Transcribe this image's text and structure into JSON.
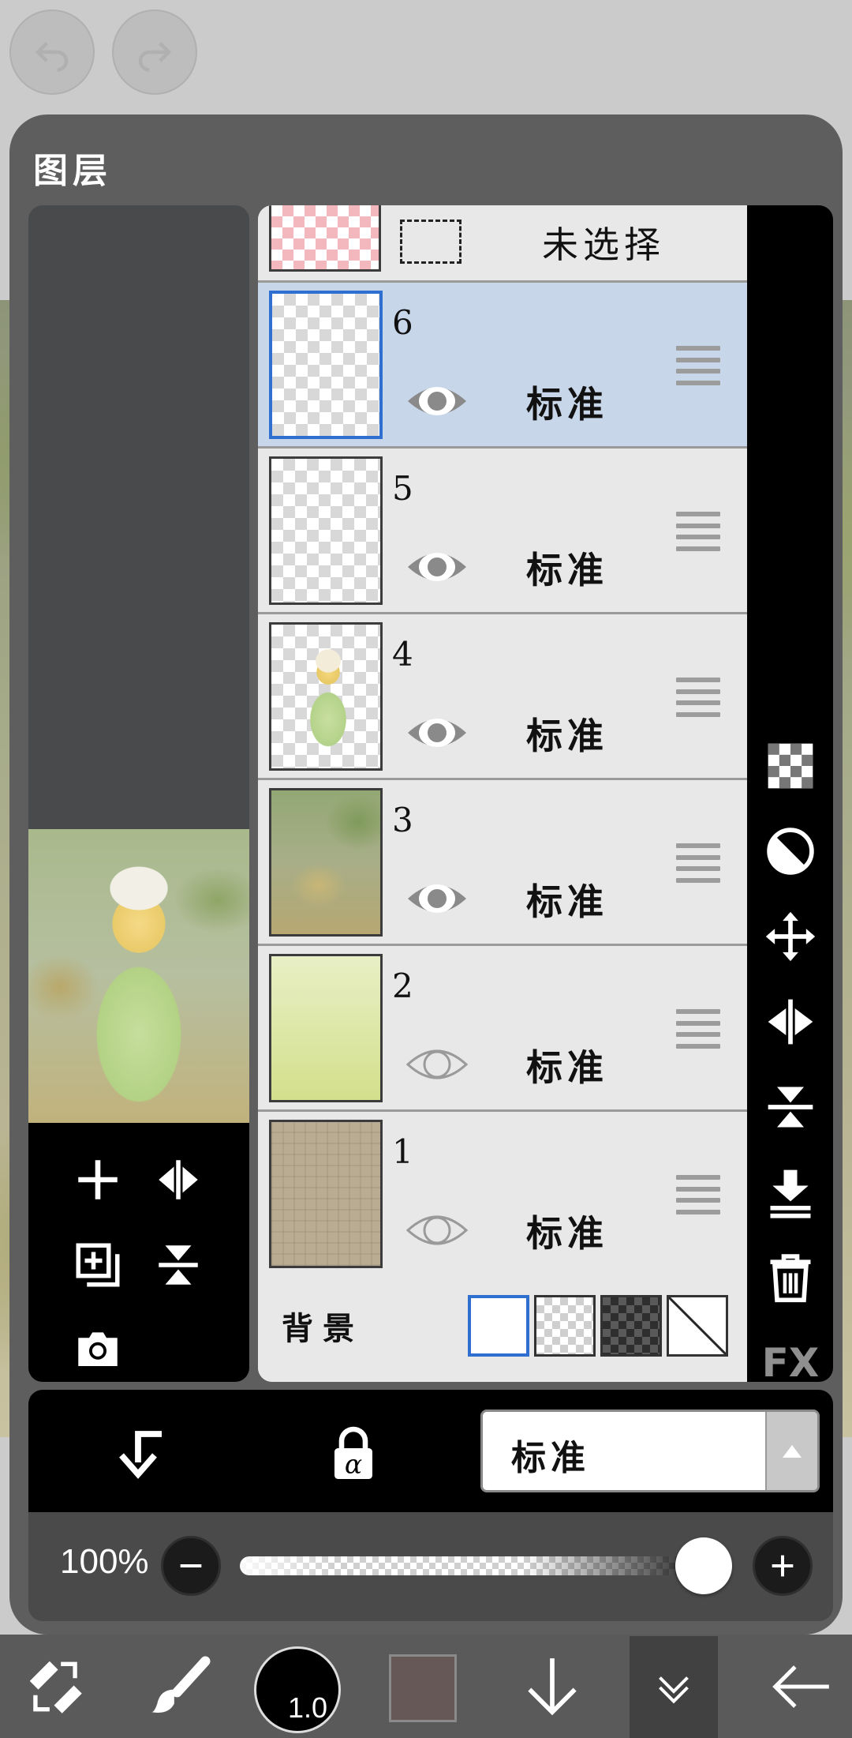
{
  "panel": {
    "title": "图层"
  },
  "layers": {
    "unselected_label": "未选择",
    "items": [
      {
        "number": "6",
        "blend": "标准",
        "visible": true,
        "selected": true
      },
      {
        "number": "5",
        "blend": "标准",
        "visible": true,
        "selected": false
      },
      {
        "number": "4",
        "blend": "标准",
        "visible": true,
        "selected": false
      },
      {
        "number": "3",
        "blend": "标准",
        "visible": true,
        "selected": false
      },
      {
        "number": "2",
        "blend": "标准",
        "visible": false,
        "selected": false
      },
      {
        "number": "1",
        "blend": "标准",
        "visible": false,
        "selected": false
      }
    ],
    "background_label": "背景"
  },
  "right_tools": {
    "fx_label": "FX"
  },
  "action_bar": {
    "blend_mode": "标准",
    "alpha_lock_symbol": "α"
  },
  "opacity": {
    "label": "100%",
    "value": 1.0
  },
  "bottom_bar": {
    "brush_size": "1.0",
    "current_color": "#665856"
  },
  "colors": {
    "selected_row": "#c8d6ea",
    "selected_border": "#2f6fd0",
    "panel_bg": "#5e5e5e"
  }
}
